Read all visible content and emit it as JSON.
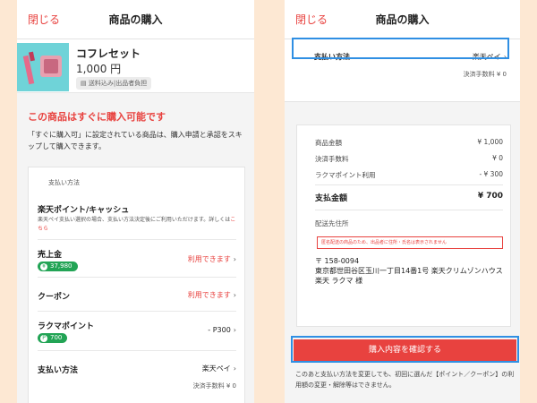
{
  "left": {
    "header": {
      "close": "閉じる",
      "title": "商品の購入"
    },
    "product": {
      "name": "コフレセット",
      "price": "1,000 円",
      "shipping": "送料込み|出品者負担"
    },
    "available_title": "この商品はすぐに購入可能です",
    "description": "「すぐに購入可」に設定されている商品は、購入申請と承認をスキップして購入できます。",
    "payment_section": "支払い方法",
    "payment_option": "楽天ポイント/キャッシュ",
    "payment_note": "楽天ペイ支払い選択の場合、支払い方法決定後にご利用いただけます。詳しくは",
    "payment_link": "こちら",
    "rows": {
      "sales": {
        "label": "売上金",
        "badge": "37,980",
        "value": "利用できます"
      },
      "coupon": {
        "label": "クーポン",
        "value": "利用できます"
      },
      "points": {
        "label": "ラクマポイント",
        "badge": "700",
        "value": "- P300"
      },
      "method": {
        "label": "支払い方法",
        "value": "楽天ペイ",
        "fee": "決済手数料 ¥ 0"
      }
    }
  },
  "right": {
    "header": {
      "close": "閉じる",
      "title": "商品の購入"
    },
    "payment": {
      "label": "支払い方法",
      "value": "楽天ペイ",
      "fee": "決済手数料 ¥ 0"
    },
    "summary": {
      "item_price": {
        "label": "商品金額",
        "value": "¥ 1,000"
      },
      "fee": {
        "label": "決済手数料",
        "value": "¥ 0"
      },
      "points": {
        "label": "ラクマポイント利用",
        "value": "- ¥ 300"
      },
      "total": {
        "label": "支払金額",
        "value": "¥ 700"
      }
    },
    "address": {
      "label": "配送先住所",
      "warning": "匿名配送の商品のため、出品者に住所・氏名は表示されません",
      "postal": "〒 158-0094",
      "line1": "東京都世田谷区玉川一丁目14番1号 楽天クリムゾンハウス",
      "name": "楽天 ラクマ 様"
    },
    "confirm_button": "購入内容を確認する",
    "note": "このあと支払い方法を変更しても、初回に選んだ【ポイント／クーポン】の利用額の変更・解除等はできません。"
  }
}
